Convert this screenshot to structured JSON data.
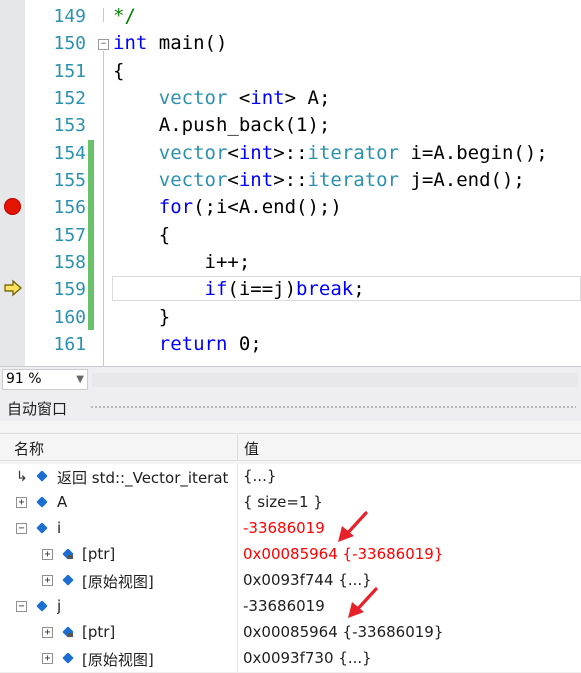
{
  "editor": {
    "lines": [
      {
        "num": "149",
        "code": "*/"
      },
      {
        "num": "150",
        "code": "int main()"
      },
      {
        "num": "151",
        "code": "{"
      },
      {
        "num": "152",
        "code": "    vector <int> A;"
      },
      {
        "num": "153",
        "code": "    A.push_back(1);"
      },
      {
        "num": "154",
        "code": "    vector<int>::iterator i=A.begin();"
      },
      {
        "num": "155",
        "code": "    vector<int>::iterator j=A.end();"
      },
      {
        "num": "156",
        "code": "    for(;i<A.end();)"
      },
      {
        "num": "157",
        "code": "    {"
      },
      {
        "num": "158",
        "code": "        i++;"
      },
      {
        "num": "159",
        "code": "        if(i==j)break;"
      },
      {
        "num": "160",
        "code": "    }"
      },
      {
        "num": "161",
        "code": "    return 0;"
      }
    ],
    "breakpoint_line": "156",
    "current_line": "159"
  },
  "zoom": {
    "level": "91 %"
  },
  "autos": {
    "title": "自动窗口",
    "columns": {
      "name": "名称",
      "value": "值"
    },
    "rows": [
      {
        "name": "返回 std::_Vector_iterat",
        "value": "{...}",
        "indent": 0,
        "expander": "none",
        "value_changed": false
      },
      {
        "name": "A",
        "value": "{ size=1 }",
        "indent": 0,
        "expander": "plus",
        "value_changed": false
      },
      {
        "name": "i",
        "value": "-33686019",
        "indent": 0,
        "expander": "minus",
        "value_changed": true
      },
      {
        "name": "[ptr]",
        "value": "0x00085964 {-33686019}",
        "indent": 1,
        "expander": "plus",
        "value_changed": true
      },
      {
        "name": "[原始视图]",
        "value": "0x0093f744 {...}",
        "indent": 1,
        "expander": "plus",
        "value_changed": false
      },
      {
        "name": "j",
        "value": "-33686019",
        "indent": 0,
        "expander": "minus",
        "value_changed": false
      },
      {
        "name": "[ptr]",
        "value": "0x00085964 {-33686019}",
        "indent": 1,
        "expander": "plus",
        "value_changed": false
      },
      {
        "name": "[原始视图]",
        "value": "0x0093f730 {...}",
        "indent": 1,
        "expander": "plus",
        "value_changed": false
      }
    ]
  },
  "colors": {
    "keyword": "#0000ff",
    "type": "#2b91af",
    "changed_value": "#ff0000",
    "breakpoint": "#e51400",
    "annotation_arrow": "#e8202a"
  }
}
